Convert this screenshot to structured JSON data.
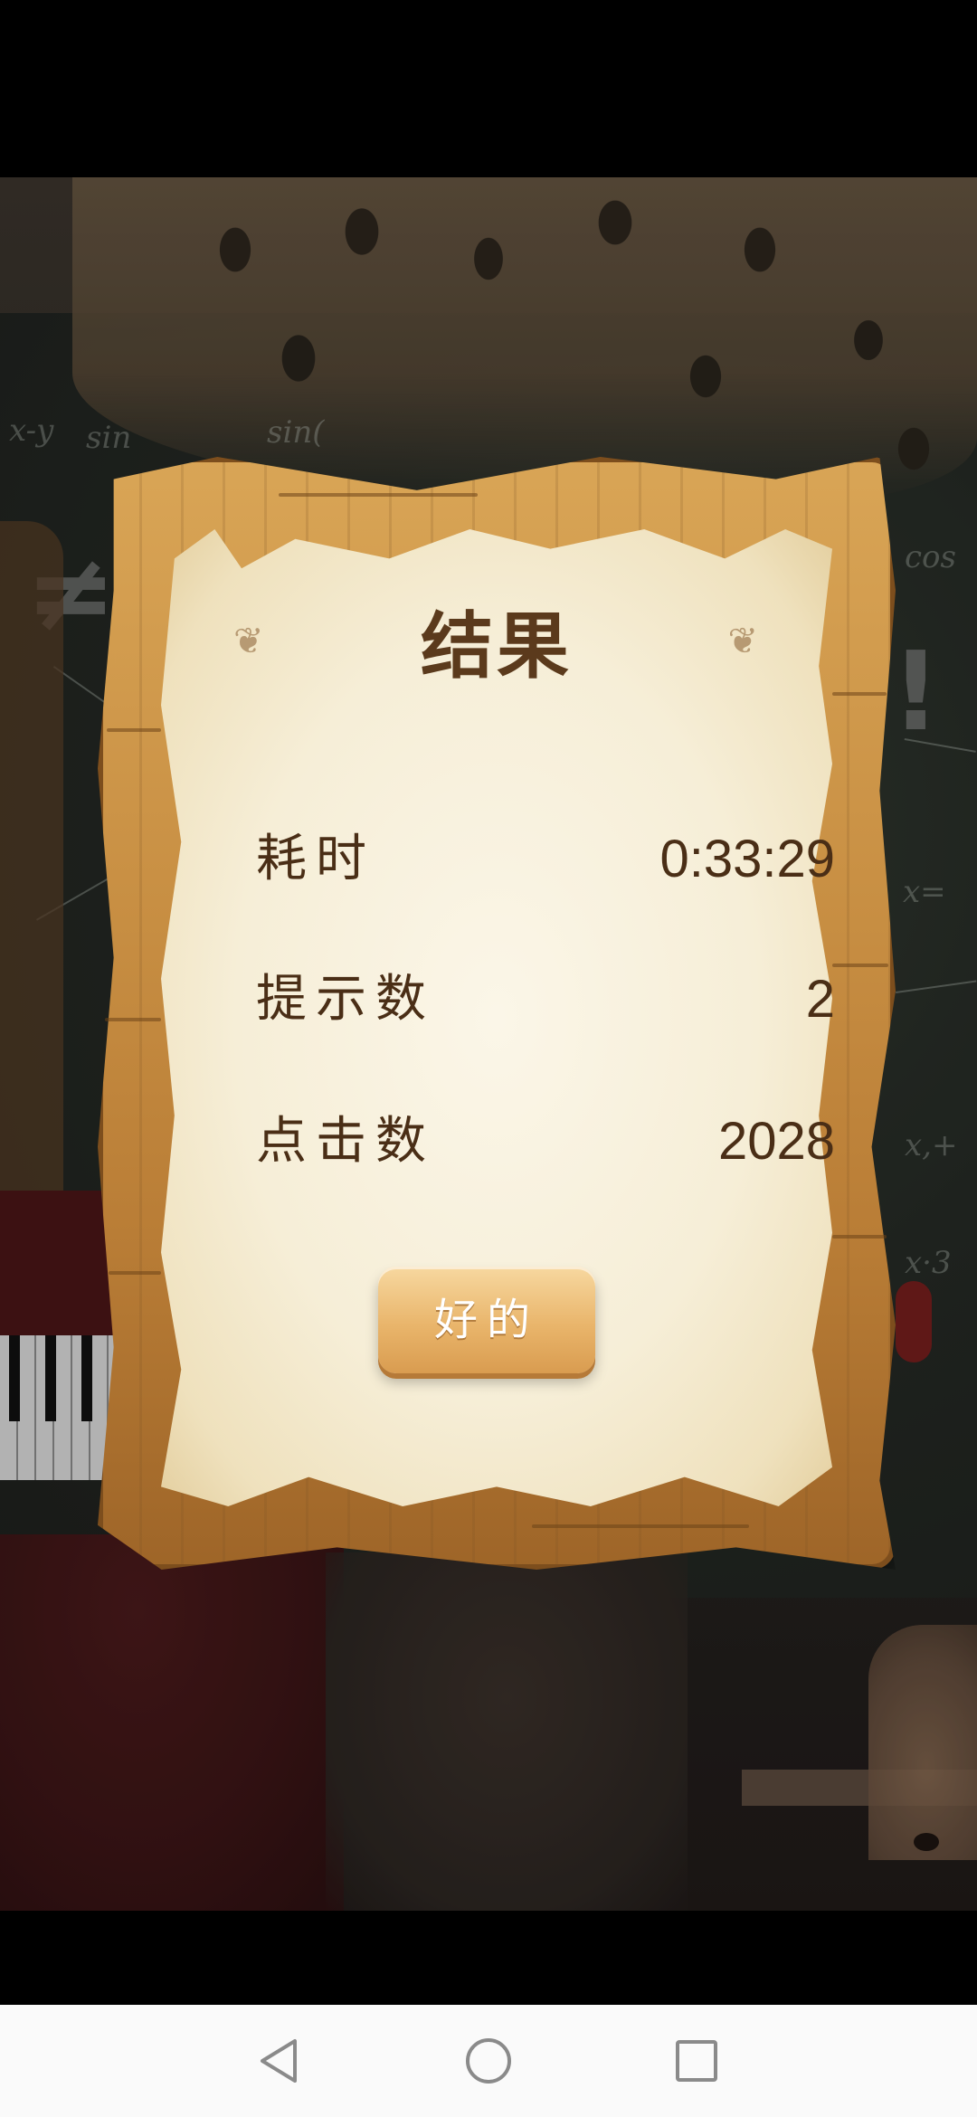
{
  "dialog": {
    "title": "结果",
    "stats": [
      {
        "label": "耗时",
        "value": "0:33:29"
      },
      {
        "label": "提示数",
        "value": "2"
      },
      {
        "label": "点击数",
        "value": "2028"
      }
    ],
    "ok_label": "好的"
  },
  "background": {
    "chalk_formulas": [
      "x-y",
      "sin",
      "sin(",
      "cos",
      "x=",
      "x,+",
      "x·3"
    ]
  },
  "navigation": {
    "icons": [
      "back-icon",
      "home-icon",
      "recent-apps-icon"
    ]
  },
  "colors": {
    "title_text": "#5b3a1c",
    "stat_text": "#4a2e16",
    "wood": "#c88f43",
    "parchment": "#f6eed7",
    "button": "#e9b56b"
  }
}
